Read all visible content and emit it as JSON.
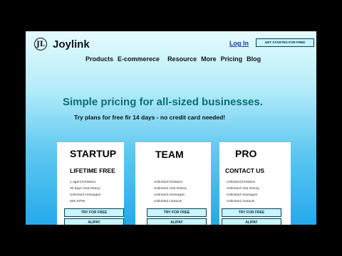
{
  "header": {
    "brand": "Joylink",
    "logo_letters": "JL",
    "login_label": "Log In",
    "cta_label": "GET STARTED FOR FREE"
  },
  "nav": {
    "items": [
      "Products",
      "E-commerece",
      "Resource",
      "More",
      "Pricing",
      "Blog"
    ]
  },
  "hero": {
    "title": "Simple pricing for all-sized businesses.",
    "subtitle": "Try plans for free fir 14 days - no credit card needed!"
  },
  "plans": [
    {
      "name": "STARTUP",
      "subtitle": "LIFETIME FREE",
      "features": [
        "1 agent limitation",
        "30 days chat history",
        "Unlimited messages",
        "50K MTW"
      ],
      "try_label": "TRY FOR FREE",
      "alipay_label": "ALIPAY"
    },
    {
      "name": "TEAM",
      "subtitle": "",
      "features": [
        "Unlimited limitation",
        "Unlimited chat history",
        "Unlimited messages",
        "Unlimited contacts"
      ],
      "try_label": "TRY FOR FREE",
      "alipay_label": "ALIPAY"
    },
    {
      "name": "PRO",
      "subtitle": "CONTACT US",
      "features": [
        "Unlimited limitation",
        "Unlimited chat history",
        "Unlimited messages",
        "Unlimited contacts"
      ],
      "try_label": "TRY FOR FREE",
      "alipay_label": "ALIPAY"
    }
  ],
  "colors": {
    "hero_title": "#0a6e73",
    "login_link": "#123a99",
    "button_fill": "#c7f6ff",
    "button_border": "#0b3b55"
  }
}
